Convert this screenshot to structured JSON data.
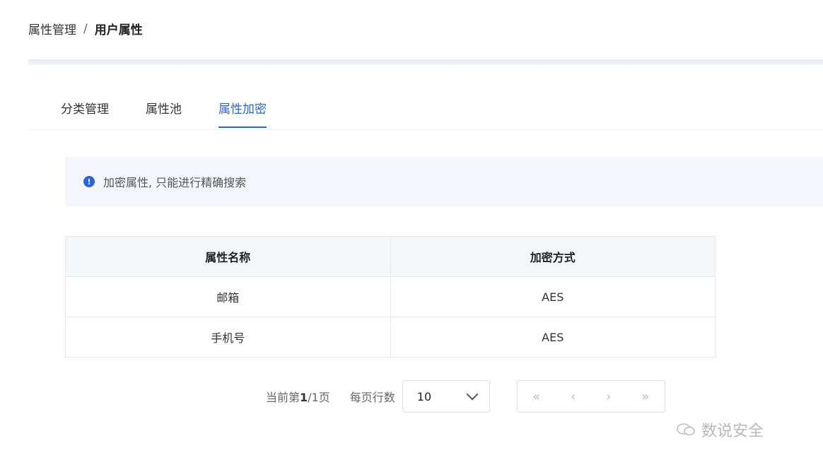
{
  "breadcrumb": {
    "parent": "属性管理",
    "separator": "/",
    "current": "用户属性"
  },
  "tabs": [
    {
      "label": "分类管理",
      "active": false
    },
    {
      "label": "属性池",
      "active": false
    },
    {
      "label": "属性加密",
      "active": true
    }
  ],
  "alert": {
    "icon": "info-icon",
    "text": "加密属性, 只能进行精确搜索"
  },
  "table": {
    "headers": [
      "属性名称",
      "加密方式"
    ],
    "rows": [
      [
        "邮箱",
        "AES"
      ],
      [
        "手机号",
        "AES"
      ]
    ]
  },
  "pagination": {
    "info_prefix": "当前第",
    "current_page": "1",
    "info_sep": "/",
    "total_pages": "1",
    "info_suffix": "页",
    "page_size_label": "每页行数",
    "page_size": "10",
    "first": "«",
    "prev": "‹",
    "next": "›",
    "last": "»"
  },
  "watermark": {
    "text": "数说安全"
  },
  "colors": {
    "accent": "#2b63d8",
    "header_bg": "#f5f6f8",
    "alert_bg": "#f4f6fb"
  }
}
